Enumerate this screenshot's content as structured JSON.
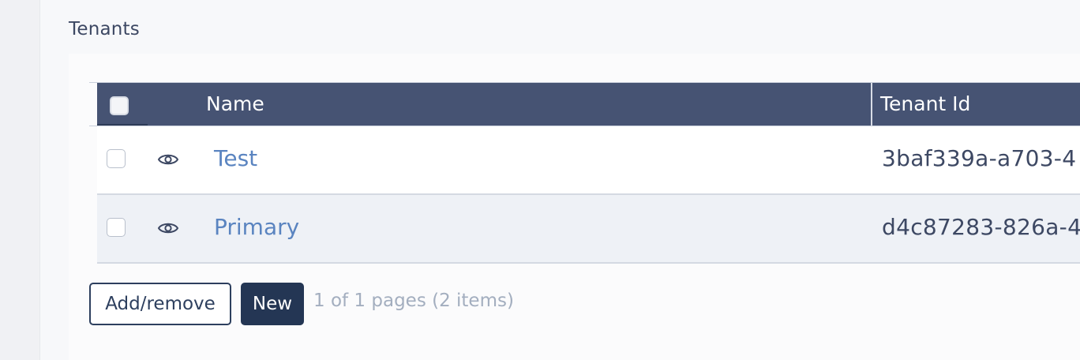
{
  "section": {
    "title": "Tenants"
  },
  "table": {
    "columns": {
      "name": "Name",
      "tenant_id": "Tenant Id"
    },
    "rows": [
      {
        "name": "Test",
        "tenant_id": "3baf339a-a703-4"
      },
      {
        "name": "Primary",
        "tenant_id": "d4c87283-826a-4"
      }
    ]
  },
  "footer": {
    "add_remove_label": "Add/remove",
    "new_label": "New",
    "pager_text": "1 of 1 pages (2 items)"
  },
  "icons": {
    "row_action": "eye-icon"
  },
  "colors": {
    "header_bg": "#465373",
    "link": "#5a84c0",
    "primary_button": "#243654"
  }
}
